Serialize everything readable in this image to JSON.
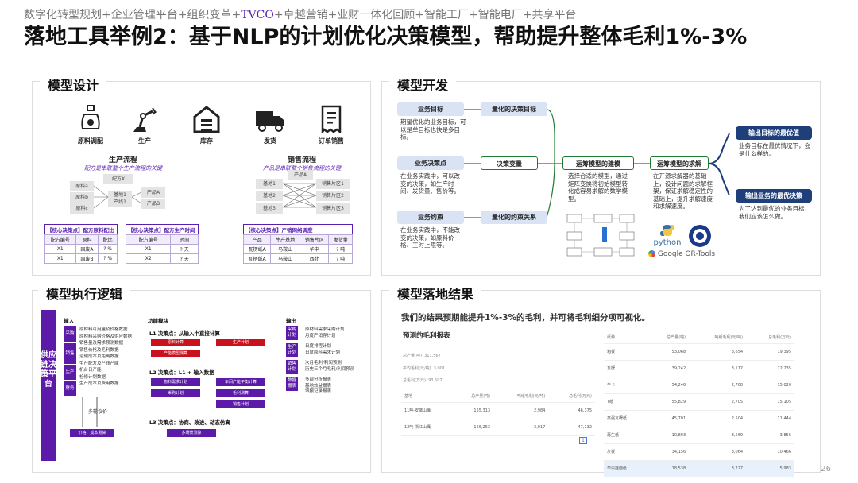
{
  "header": {
    "breadcrumb_a": "数字化转型规划+企业管理平台+组织变革+",
    "breadcrumb_hl": "TVCO",
    "breadcrumb_b": "+卓越营销+业财一体化回顾+智能工厂+智能电厂+共享平台"
  },
  "title": "落地工具举例2：基于NLP的计划优化决策模型，帮助提升整体毛利1%-3%",
  "page_number": "26",
  "panels": {
    "design": {
      "label": "模型设计",
      "icons": [
        "原料调配",
        "生产",
        "库存",
        "发货",
        "订单销售"
      ],
      "production_flow": {
        "title": "生产流程",
        "subtitle": "配方是串联整个生产流程的关键",
        "formula": "配方X",
        "materials": [
          "原料a",
          "原料b",
          "原料c"
        ],
        "bases": [
          "基地1",
          "产线1"
        ],
        "products": [
          "产品A",
          "产品B"
        ]
      },
      "sales_flow": {
        "title": "销售流程",
        "subtitle": "产品是串联整个销售流程的关键",
        "product": "产品A",
        "bases": [
          "基地1",
          "基地2",
          "基地3"
        ],
        "regions": [
          "销售片区1",
          "销售片区2",
          "销售片区3"
        ]
      },
      "table1": {
        "caption": "【核心决策点】配方原料配比",
        "headers": [
          "配方编号",
          "原料",
          "配比"
        ],
        "rows": [
          [
            "X1",
            "国废A",
            "? %"
          ],
          [
            "X1",
            "国废B",
            "? %"
          ]
        ]
      },
      "table2": {
        "caption": "【核心决策点】配方生产时间",
        "headers": [
          "配方编号",
          "时间"
        ],
        "rows": [
          [
            "X1",
            "? 天"
          ],
          [
            "X2",
            "? 天"
          ]
        ]
      },
      "table3": {
        "caption": "【核心决策点】产销网络调度",
        "headers": [
          "产品",
          "生产基地",
          "销售片区",
          "发货量"
        ],
        "rows": [
          [
            "瓦楞纸A",
            "马鞍山",
            "华中",
            "? 吨"
          ],
          [
            "瓦楞纸A",
            "马鞍山",
            "西北",
            "? 吨"
          ]
        ]
      }
    },
    "dev": {
      "label": "模型开发",
      "nodes": {
        "goal": "业务目标",
        "quant_goal": "量化的决策目标",
        "decision": "业务决策点",
        "var": "决策变量",
        "constraint": "业务约束",
        "quant_con": "量化的约束关系",
        "build": "运筹模型的建模",
        "solve": "运筹模型的求解",
        "out1": "输出目标的最优值",
        "out2": "输出业务的最优决策"
      },
      "desc": {
        "goal": "期望优化的业务目标，可以是单目标也快是多目标。",
        "decision": "在业务实践中，可以改变的决策，如生产时间、发货量、售价等。",
        "constraint": "在业务实践中，不能改变的决策，如原料价格、工时上限等。",
        "build": "选择合适的模型，通过矩阵变换将初始模型转化成容易求解的数学模型。",
        "solve": "在开源求解器的基础上，设计问题的求解框架，保证求解稳定性的基础上，提升求解速度和求解速度。",
        "out1": "业务目标在最优情况下，会是什么样的。",
        "out2": "为了达到最优的业务目标，我们应该怎么做。"
      },
      "logos": {
        "python": "python",
        "ortools": "Google OR-Tools"
      }
    },
    "exec": {
      "label": "模型执行逻辑",
      "side": "供应链决策平台",
      "col_input": "输入",
      "col_func": "功能模块",
      "col_output": "输出",
      "in_tags": [
        "采购",
        "销售",
        "生产",
        "财务"
      ],
      "in_lines": [
        "原材料可用量及价格数据",
        "原材料采购价格及供应数据",
        "销售量及需求预测数据",
        "销售价格及毛利数据",
        "运输成本及距离数据",
        "生产配方及产线产能",
        "机台日产能",
        "检修计划数据",
        "生产成本及费用数据"
      ],
      "loop": "多轮议价",
      "price_box": "价格、成本测算",
      "l1": "L1 决策点：从输入中直接计算",
      "l2": "L2 决策点：L1 + 输入数据",
      "l3": "L3 决策点：协商、改进、动态仿真",
      "l1_boxes": [
        "原料计算",
        "生产计划",
        "产能模型测算"
      ],
      "l2_boxes": [
        "物料需求计划",
        "车间产能平衡计算",
        "采购计划",
        "毛利测算",
        "销售计划"
      ],
      "l3_box": "多场景测算",
      "out_tags": [
        "采购计划",
        "生产计划",
        "销售计划",
        "数据报表"
      ],
      "out_lines": [
        "原材料需求采购计划",
        "月度产销存计划",
        "日度排程计划",
        "日度原料需求计划",
        "次月毛利/利润预测",
        "历史三个月毛利/利润预测",
        "多部分析报表",
        "基地效益报表",
        "填报记录报表"
      ]
    },
    "result": {
      "label": "模型落地结果",
      "headline": "我们的结果预期能提升1%-3%的毛利，并可将毛利细分项可视化。",
      "report_title": "预测的毛利报表",
      "left_stats": [
        [
          "总产量(吨)",
          "311,567"
        ],
        [
          "平均毛利(元/吨)",
          "3,001"
        ],
        [
          "总毛利(万元)",
          "93,507"
        ]
      ],
      "left_headers": [
        "基地",
        "总产量(吨)",
        "吨纸毛利(元/吨)",
        "总毛利(万元)"
      ],
      "left_rows": [
        [
          "11吨-安徽山鹰",
          "155,313",
          "2,984",
          "46,375"
        ],
        [
          "12吨-浙江山鹰",
          "156,253",
          "3,017",
          "47,132"
        ]
      ],
      "pager": "1",
      "right_headers": [
        "纸种",
        "总产量(吨)",
        "吨纸毛利(元/吨)",
        "总毛利(万元)"
      ],
      "right_rows": [
        [
          "箱板",
          "53,068",
          "3,654",
          "19,395"
        ],
        [
          "瓦楞",
          "39,242",
          "3,117",
          "12,235"
        ],
        [
          "牛卡",
          "54,246",
          "2,768",
          "15,020"
        ],
        [
          "T纸",
          "55,829",
          "2,705",
          "15,105"
        ],
        [
          "高强瓦楞纸",
          "45,701",
          "2,504",
          "11,444"
        ],
        [
          "再生纸",
          "10,803",
          "3,569",
          "3,856"
        ],
        [
          "灰板",
          "34,156",
          "3,064",
          "10,466"
        ],
        [
          "单白挂面纸",
          "18,538",
          "3,227",
          "5,983"
        ]
      ]
    }
  },
  "colors": {
    "purple": "#5b1aa8",
    "red": "#c9121e",
    "navy": "#1f3f7a",
    "green": "#1e7a32"
  }
}
